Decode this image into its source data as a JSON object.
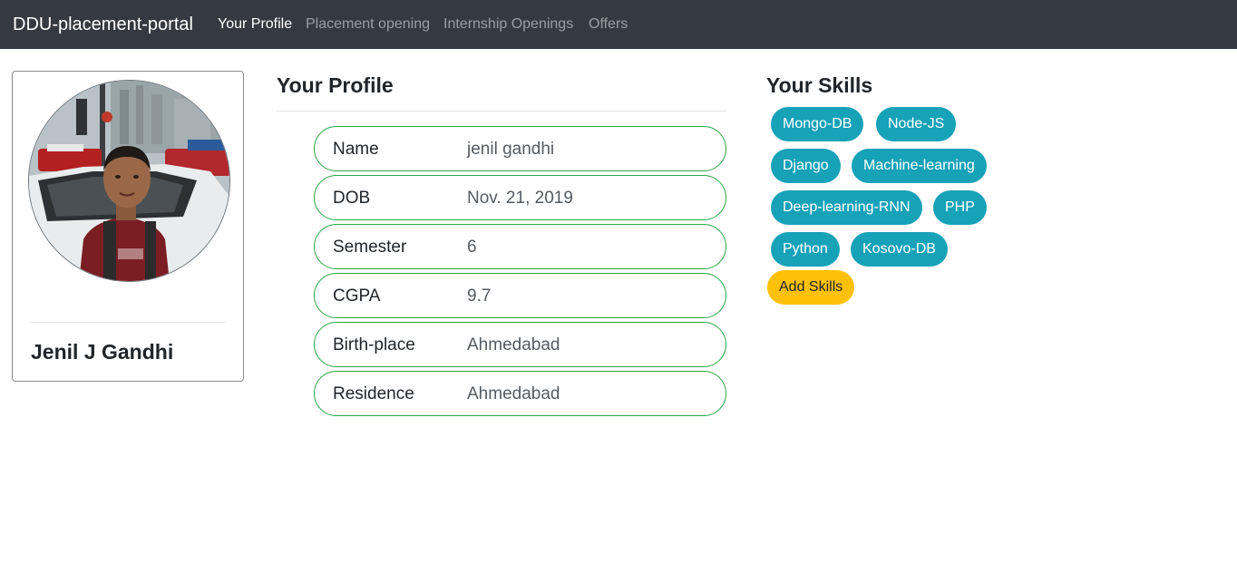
{
  "navbar": {
    "brand": "DDU-placement-portal",
    "links": [
      {
        "label": "Your Profile",
        "active": true
      },
      {
        "label": "Placement opening",
        "active": false
      },
      {
        "label": "Internship Openings",
        "active": false
      },
      {
        "label": "Offers",
        "active": false
      }
    ]
  },
  "profile_card": {
    "name": "Jenil J Gandhi"
  },
  "profile": {
    "title": "Your Profile",
    "rows": [
      {
        "label": "Name",
        "value": "jenil gandhi"
      },
      {
        "label": "DOB",
        "value": "Nov. 21, 2019"
      },
      {
        "label": "Semester",
        "value": "6"
      },
      {
        "label": "CGPA",
        "value": "9.7"
      },
      {
        "label": "Birth-place",
        "value": "Ahmedabad"
      },
      {
        "label": "Residence",
        "value": "Ahmedabad"
      }
    ]
  },
  "skills": {
    "title": "Your Skills",
    "items": [
      "Mongo-DB",
      "Node-JS",
      "Django",
      "Machine-learning",
      "Deep-learning-RNN",
      "PHP",
      "Python",
      "Kosovo-DB"
    ],
    "add_label": "Add Skills"
  },
  "colors": {
    "navbar_bg": "#343a40",
    "row_border": "#28a745",
    "skill_badge": "#17a2b8",
    "add_button": "#ffc107"
  }
}
